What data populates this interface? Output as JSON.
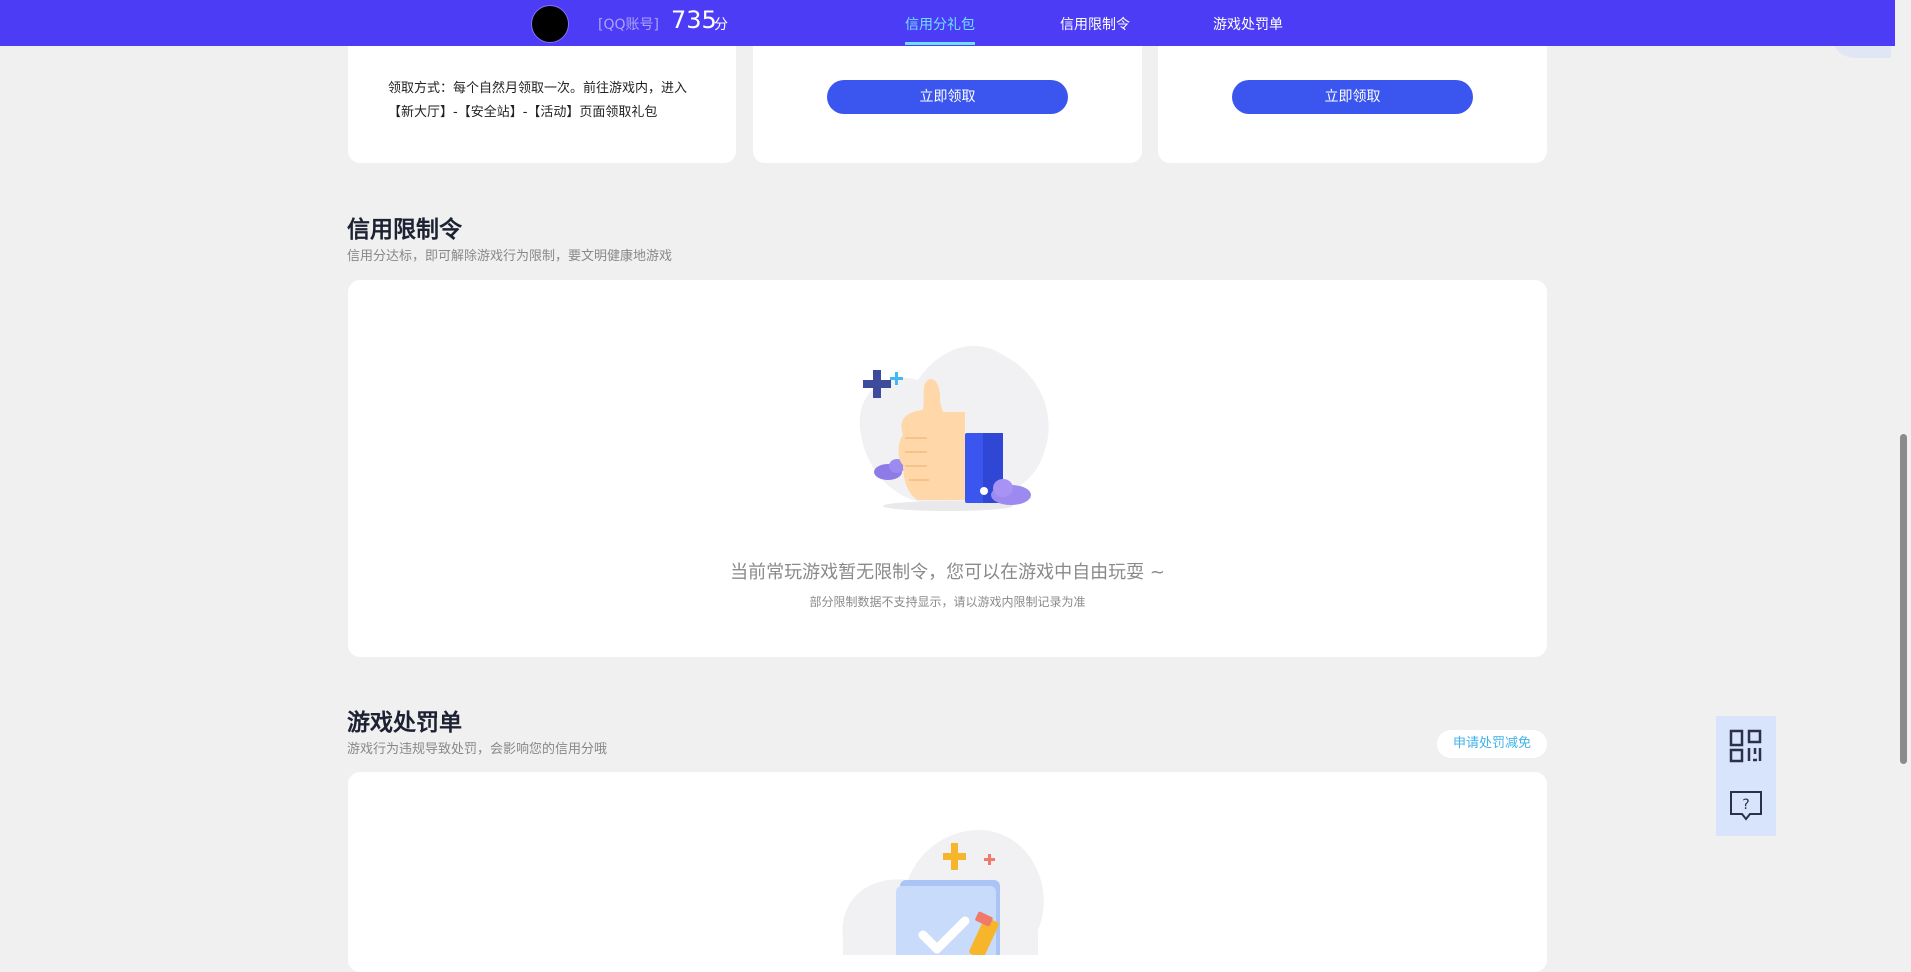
{
  "header": {
    "account_label": "[QQ账号]",
    "score": "735",
    "score_unit": "分",
    "nav": [
      "信用分礼包",
      "信用限制令",
      "游戏处罚单"
    ]
  },
  "gift_cards": {
    "card1_desc": "领取方式：每个自然月领取一次。前往游戏内，进入【新大厅】-【安全站】-【活动】页面领取礼包",
    "claim_label": "立即领取"
  },
  "restriction": {
    "title": "信用限制令",
    "subtitle": "信用分达标，即可解除游戏行为限制，要文明健康地游戏",
    "empty_main": "当前常玩游戏暂无限制令，您可以在游戏中自由玩耍 ~",
    "empty_sub": "部分限制数据不支持显示，请以游戏内限制记录为准"
  },
  "penalty": {
    "title": "游戏处罚单",
    "subtitle": "游戏行为违规导致处罚，会影响您的信用分哦",
    "appeal_label": "申请处罚减免"
  },
  "icons": [
    "qr-code-icon",
    "help-chat-icon",
    "thumbs-up-illustration",
    "document-check-illustration"
  ],
  "colors": {
    "header": "#4d3cf5",
    "button": "#3b56ef",
    "accent": "#6ee0ff"
  }
}
